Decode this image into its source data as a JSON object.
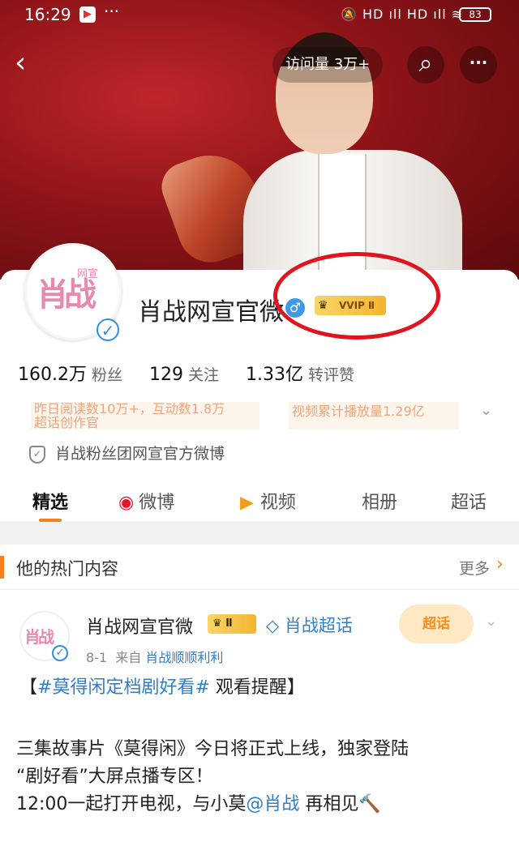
{
  "status_bar": {
    "time": "16:29",
    "app_icon": "▶",
    "dots": "···",
    "signals": "🔕 HD ıll HD ıll ≋",
    "battery": "83"
  },
  "nav": {
    "back_icon": "‹",
    "visit_label": "访问量 3万+",
    "search_icon": "⌕",
    "more_icon": "···"
  },
  "profile": {
    "avatar_text": "肖战",
    "avatar_small": "网宣",
    "name": "肖战网宣官微",
    "gender_icon": "♂",
    "vip_crown": "♛",
    "vip_label": "VVIP Ⅱ",
    "verified_icon": "✓",
    "fans_value": "160.2万",
    "fans_label": "粉丝",
    "following_value": "129",
    "following_label": "关注",
    "likes_value": "1.33亿",
    "likes_label": "转评赞",
    "tag1_line1": "昨日阅读数10万+，互动数1.8万",
    "tag1_line2": "超话创作官",
    "tag2": "视频累计播放量1.29亿",
    "expand_icon": "⌄",
    "group_label": "肖战粉丝团网宣官方微博",
    "shield_icon": "✓"
  },
  "tabs": [
    {
      "label": "精选",
      "icon": ""
    },
    {
      "label": "微博",
      "icon": "◉"
    },
    {
      "label": "视频",
      "icon": "▶"
    },
    {
      "label": "相册",
      "icon": ""
    },
    {
      "label": "超话",
      "icon": ""
    }
  ],
  "hot": {
    "title": "他的热门内容",
    "more": "更多",
    "arrow": "›"
  },
  "post": {
    "avatar_text": "肖战",
    "author": "肖战网宣官微",
    "crown_label": "♛ Ⅱ",
    "supertopic": "◇ 肖战超话",
    "sticker": "超话",
    "chevron": "⌄",
    "date": "8-1",
    "from_label": "来自",
    "source": "肖战顺顺利利",
    "topic": "#莫得闲定档剧好看#",
    "topic_bracket_open": "【",
    "topic_suffix": " 观看提醒】",
    "line1": "三集故事片《莫得闲》今日将正式上线，独家登陆",
    "line2": "“剧好看”大屏点播专区！",
    "line3_pre": "12:00一起打开电视，与小莫",
    "mention": "@肖战",
    "line3_post": " 再相见🔨"
  }
}
